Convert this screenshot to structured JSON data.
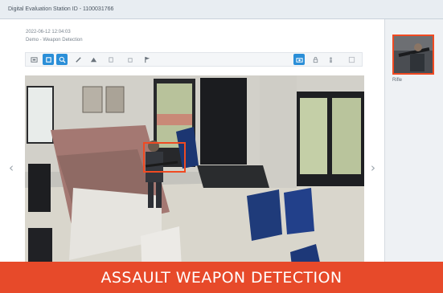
{
  "window": {
    "title": "Digital Evaluation Station ID - 1100031766"
  },
  "event": {
    "timestamp": "2022-06-12 12:04:03",
    "description": "Demo - Weapon Detection"
  },
  "toolbar": {
    "left_tools": [
      "zoom-out-icon",
      "select-icon",
      "zoom-in-icon",
      "pencil-icon",
      "marker-icon",
      "copy-icon",
      "paste-icon",
      "flag-icon"
    ],
    "right_tools": [
      "camera-icon",
      "lock-icon",
      "person-icon",
      "expand-icon"
    ],
    "active": [
      "select-icon",
      "zoom-in-icon",
      "camera-icon"
    ]
  },
  "navigation": {
    "prev_glyph": "‹",
    "next_glyph": "›"
  },
  "thumbnail": {
    "label": "Rifle"
  },
  "banner": {
    "text": "ASSAULT WEAPON DETECTION"
  },
  "colors": {
    "accent": "#2b8fd8",
    "alert": "#e74a2a",
    "detection_box": "#f04a22"
  }
}
